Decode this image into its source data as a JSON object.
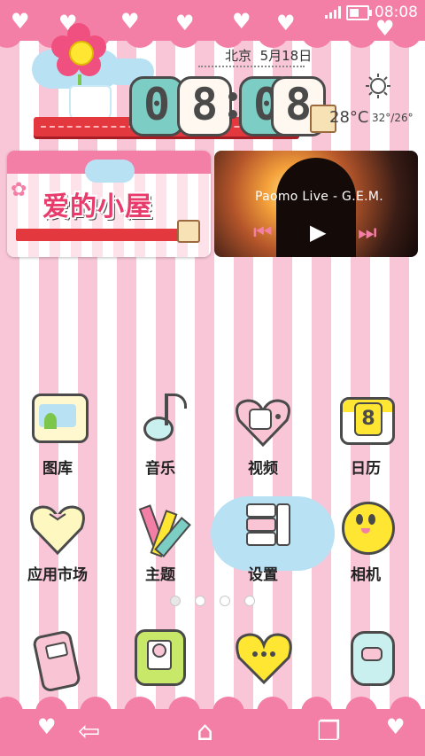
{
  "status_bar": {
    "time": "08:08",
    "colors": {
      "band": "#f47fa6"
    }
  },
  "clock_widget": {
    "digits": [
      "0",
      "8",
      "0",
      "8"
    ],
    "city": "北京",
    "date": "5月18日",
    "temperature": "28°C",
    "temp_range": "32°/26°",
    "weather_icon": "sun-icon"
  },
  "love_card": {
    "title": "爱的小屋"
  },
  "music_card": {
    "track": "Paomo Live - G.E.M.",
    "controls": [
      "previous-icon",
      "play-icon",
      "next-icon"
    ]
  },
  "apps_row1": [
    {
      "name": "gallery",
      "label": "图库"
    },
    {
      "name": "music",
      "label": "音乐"
    },
    {
      "name": "video",
      "label": "视频"
    },
    {
      "name": "calendar",
      "label": "日历",
      "badge": "8"
    }
  ],
  "apps_row2": [
    {
      "name": "app-market",
      "label": "应用市场"
    },
    {
      "name": "theme",
      "label": "主题"
    },
    {
      "name": "settings",
      "label": "设置"
    },
    {
      "name": "camera",
      "label": "相机"
    }
  ],
  "dock": [
    {
      "name": "phone-icon"
    },
    {
      "name": "contacts-icon"
    },
    {
      "name": "messages-icon"
    },
    {
      "name": "browser-icon"
    }
  ],
  "pager": {
    "pages": 4,
    "current": 1
  },
  "navigation": [
    "back-icon",
    "home-icon",
    "recent-apps-icon"
  ]
}
